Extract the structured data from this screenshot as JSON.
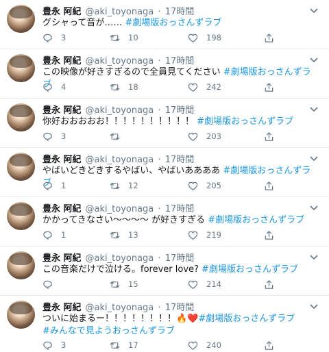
{
  "tweets": [
    {
      "name": "豊永 阿紀",
      "handle": "@aki_toyonaga",
      "sep": "·",
      "time": "17時間",
      "text": "グシャって音が…… ",
      "text2": "",
      "hashtag": "#劇場版おっさんずラブ",
      "hashtag2": "",
      "replies": "3",
      "retweets": "10",
      "likes": "198"
    },
    {
      "name": "豊永 阿紀",
      "handle": "@aki_toyonaga",
      "sep": "·",
      "time": "17時間",
      "text": "この映像が好きすぎるので全員見てください ",
      "text2": "",
      "hashtag": "#劇場版おっさんずラブ",
      "hashtag2": "",
      "replies": "4",
      "retweets": "18",
      "likes": "242"
    },
    {
      "name": "豊永 阿紀",
      "handle": "@aki_toyonaga",
      "sep": "·",
      "time": "17時間",
      "text": "你好おおおおお！！！！！！！！！！ ",
      "text2": "",
      "hashtag": "#劇場版おっさんずラブ",
      "hashtag2": "",
      "replies": "3",
      "retweets": "",
      "likes": "203"
    },
    {
      "name": "豊永 阿紀",
      "handle": "@aki_toyonaga",
      "sep": "·",
      "time": "17時間",
      "text": "やばいどきどきするやばい、やばいああああ ",
      "text2": "",
      "hashtag": "#劇場版おっさんずラブ",
      "hashtag2": "",
      "replies": "1",
      "retweets": "12",
      "likes": "205"
    },
    {
      "name": "豊永 阿紀",
      "handle": "@aki_toyonaga",
      "sep": "·",
      "time": "17時間",
      "text": "かかってきなさい〜〜〜〜 が好きすぎる ",
      "text2": "",
      "hashtag": "#劇場版おっさんずラブ",
      "hashtag2": "",
      "replies": "1",
      "retweets": "13",
      "likes": "219"
    },
    {
      "name": "豊永 阿紀",
      "handle": "@aki_toyonaga",
      "sep": "·",
      "time": "17時間",
      "text": "この音楽だけで泣ける。forever love? ",
      "text2": "",
      "hashtag": "#劇場版おっさんずラブ",
      "hashtag2": "",
      "replies": "",
      "retweets": "15",
      "likes": "214"
    },
    {
      "name": "豊永 阿紀",
      "handle": "@aki_toyonaga",
      "sep": "·",
      "time": "17時間",
      "text": "ついに始まるー！！！！！！！！",
      "text2": "🔥❤️",
      "hashtag": "#劇場版おっさんずラブ",
      "hashtag2": "#みんなで見ようおっさんずラブ",
      "replies": "3",
      "retweets": "17",
      "likes": "240"
    }
  ],
  "colors": {
    "link": "#1b95e0",
    "muted": "#657786",
    "text": "#14171a",
    "border": "#e6ecf0"
  },
  "icons": {
    "reply": "reply-icon",
    "retweet": "retweet-icon",
    "like": "heart-icon",
    "share": "share-icon",
    "menu": "chevron-down-icon"
  }
}
